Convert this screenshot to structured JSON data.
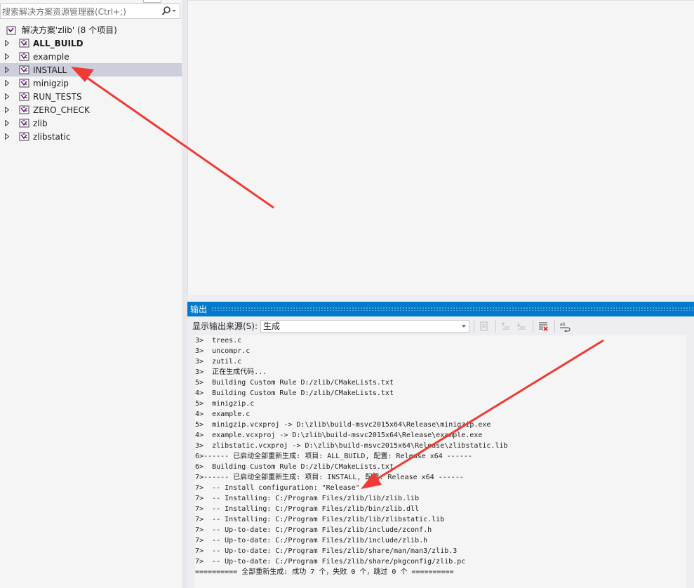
{
  "solution_explorer": {
    "search_placeholder": "搜索解决方案资源管理器(Ctrl+;)",
    "solution_label": "解决方案'zlib' (8 个项目)",
    "projects": [
      {
        "label": "ALL_BUILD",
        "bold": true,
        "selected": false
      },
      {
        "label": "example",
        "bold": false,
        "selected": false
      },
      {
        "label": "INSTALL",
        "bold": false,
        "selected": true
      },
      {
        "label": "minigzip",
        "bold": false,
        "selected": false
      },
      {
        "label": "RUN_TESTS",
        "bold": false,
        "selected": false
      },
      {
        "label": "ZERO_CHECK",
        "bold": false,
        "selected": false
      },
      {
        "label": "zlib",
        "bold": false,
        "selected": false
      },
      {
        "label": "zlibstatic",
        "bold": false,
        "selected": false
      }
    ]
  },
  "output": {
    "title": "输出",
    "source_label": "显示输出来源(S):",
    "source_value": "生成",
    "lines": [
      "3>  trees.c",
      "3>  uncompr.c",
      "3>  zutil.c",
      "3>  正在生成代码...",
      "5>  Building Custom Rule D:/zlib/CMakeLists.txt",
      "4>  Building Custom Rule D:/zlib/CMakeLists.txt",
      "5>  minigzip.c",
      "4>  example.c",
      "5>  minigzip.vcxproj -> D:\\zlib\\build-msvc2015x64\\Release\\minigzip.exe",
      "4>  example.vcxproj -> D:\\zlib\\build-msvc2015x64\\Release\\example.exe",
      "3>  zlibstatic.vcxproj -> D:\\zlib\\build-msvc2015x64\\Release\\zlibstatic.lib",
      "6>------ 已启动全部重新生成: 项目: ALL_BUILD, 配置: Release x64 ------",
      "6>  Building Custom Rule D:/zlib/CMakeLists.txt",
      "7>------ 已启动全部重新生成: 项目: INSTALL, 配置: Release x64 ------",
      "7>  -- Install configuration: \"Release\"",
      "7>  -- Installing: C:/Program Files/zlib/lib/zlib.lib",
      "7>  -- Installing: C:/Program Files/zlib/bin/zlib.dll",
      "7>  -- Installing: C:/Program Files/zlib/lib/zlibstatic.lib",
      "7>  -- Up-to-date: C:/Program Files/zlib/include/zconf.h",
      "7>  -- Up-to-date: C:/Program Files/zlib/include/zlib.h",
      "7>  -- Up-to-date: C:/Program Files/zlib/share/man/man3/zlib.3",
      "7>  -- Up-to-date: C:/Program Files/zlib/share/pkgconfig/zlib.pc",
      "========== 全部重新生成: 成功 7 个，失败 0 个，跳过 0 个 =========="
    ]
  },
  "colors": {
    "accent": "#007acc",
    "selection": "#cccedb",
    "annotation_arrow": "#ee3b36",
    "project_icon": "#68217a"
  }
}
